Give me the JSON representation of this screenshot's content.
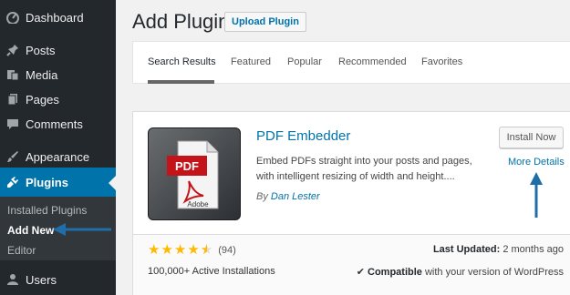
{
  "sidebar": {
    "items": [
      {
        "label": "Dashboard",
        "icon": "dashboard-icon"
      },
      {
        "label": "Posts",
        "icon": "pin-icon"
      },
      {
        "label": "Media",
        "icon": "media-icon"
      },
      {
        "label": "Pages",
        "icon": "pages-icon"
      },
      {
        "label": "Comments",
        "icon": "comments-icon"
      },
      {
        "label": "Appearance",
        "icon": "brush-icon"
      },
      {
        "label": "Plugins",
        "icon": "plug-icon"
      },
      {
        "label": "Users",
        "icon": "user-icon"
      }
    ],
    "submenu": [
      "Installed Plugins",
      "Add New",
      "Editor"
    ]
  },
  "header": {
    "title": "Add Plugins",
    "upload_label": "Upload Plugin"
  },
  "tabs": [
    "Search Results",
    "Featured",
    "Popular",
    "Recommended",
    "Favorites"
  ],
  "plugin": {
    "thumb_text": "PDF",
    "thumb_brand": "Adobe",
    "name": "PDF Embedder",
    "description": "Embed PDFs straight into your posts and pages, with intelligent resizing of width and height....",
    "author_prefix": "By",
    "author": "Dan Lester",
    "install_label": "Install Now",
    "details_label": "More Details",
    "rating_stars": 4.5,
    "rating_count": "(94)",
    "installs": "100,000+ Active Installations",
    "last_updated_label": "Last Updated:",
    "last_updated_value": "2 months ago",
    "compatible_label": "Compatible",
    "compatible_rest": "with your version of WordPress"
  },
  "colors": {
    "accent": "#0073aa",
    "sidebar_bg": "#23282d",
    "star": "#ffb900"
  }
}
